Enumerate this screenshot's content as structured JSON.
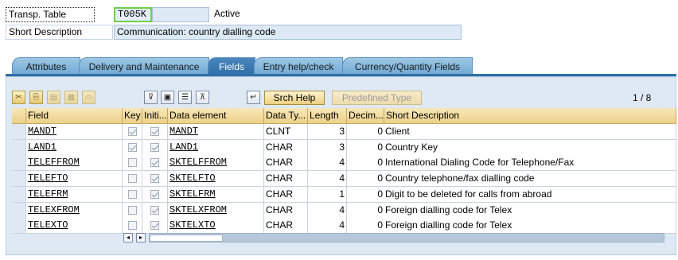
{
  "header": {
    "transp_table_label": "Transp. Table",
    "table_name": "T005K",
    "status": "Active",
    "short_desc_label": "Short Description",
    "short_desc_value": "Communication: country dialling code"
  },
  "tabs": [
    {
      "label": "Attributes"
    },
    {
      "label": "Delivery and Maintenance"
    },
    {
      "label": "Fields"
    },
    {
      "label": "Entry help/check"
    },
    {
      "label": "Currency/Quantity Fields"
    }
  ],
  "toolbar": {
    "srch_help_label": "Srch Help",
    "predefined_type_label": "Predefined Type",
    "page_indicator": "1 / 8",
    "icons": [
      "cut-icon",
      "copy-icon",
      "paste-icon",
      "insert-row-icon",
      "delete-row-icon",
      "sort-icon",
      "select-all-icon",
      "deselect-icon",
      "scroll-up-icon",
      "new-field-icon"
    ]
  },
  "table": {
    "columns": [
      "Field",
      "Key",
      "Initi...",
      "Data element",
      "Data Ty...",
      "Length",
      "Decim...",
      "Short Description"
    ],
    "rows": [
      {
        "field": "MANDT",
        "key": true,
        "init": true,
        "element": "MANDT",
        "type": "CLNT",
        "length": "3",
        "decimals": "0",
        "desc": "Client"
      },
      {
        "field": "LAND1",
        "key": true,
        "init": true,
        "element": "LAND1",
        "type": "CHAR",
        "length": "3",
        "decimals": "0",
        "desc": "Country Key"
      },
      {
        "field": "TELEFFROM",
        "key": false,
        "init": true,
        "element": "SKTELFFROM",
        "type": "CHAR",
        "length": "4",
        "decimals": "0",
        "desc": "International Dialing Code for Telephone/Fax"
      },
      {
        "field": "TELEFTO",
        "key": false,
        "init": true,
        "element": "SKTELFTO",
        "type": "CHAR",
        "length": "4",
        "decimals": "0",
        "desc": "Country telephone/fax dialling code"
      },
      {
        "field": "TELEFRM",
        "key": false,
        "init": true,
        "element": "SKTELFRM",
        "type": "CHAR",
        "length": "1",
        "decimals": "0",
        "desc": "Digit to be deleted for calls from abroad"
      },
      {
        "field": "TELEXFROM",
        "key": false,
        "init": true,
        "element": "SKTELXFROM",
        "type": "CHAR",
        "length": "4",
        "decimals": "0",
        "desc": "Foreign dialling code for  Telex"
      },
      {
        "field": "TELEXTO",
        "key": false,
        "init": true,
        "element": "SKTELXTO",
        "type": "CHAR",
        "length": "4",
        "decimals": "0",
        "desc": "Foreign dialling code for Telex"
      }
    ]
  },
  "scrollbar": {
    "left_icon": "◂",
    "right_icon": "▸"
  }
}
